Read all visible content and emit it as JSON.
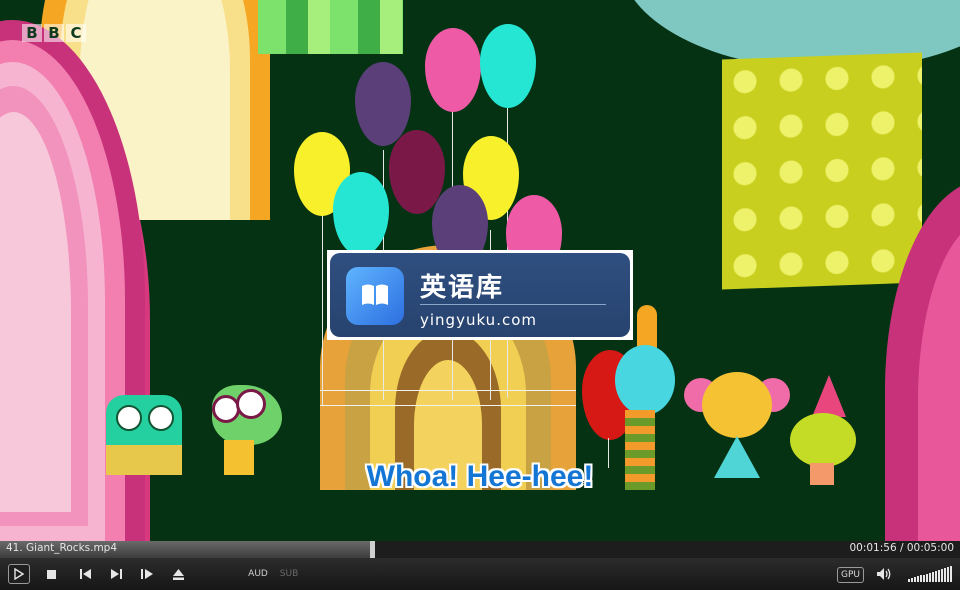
{
  "player": {
    "filename": "41. Giant_Rocks.mp4",
    "time_current": "00:01:56",
    "time_total": "00:05:00",
    "time_display": "00:01:56 / 00:05:00",
    "progress_fraction": 0.387,
    "volume_fraction": 1.0
  },
  "video": {
    "watermark_letters": [
      "B",
      "B",
      "C"
    ],
    "subtitle": "Whoa! Hee-hee!",
    "overlay_logo": {
      "title": "英语库",
      "domain": "yingyuku.com"
    }
  },
  "controls": {
    "play_icon": "play-icon",
    "stop_icon": "stop-icon",
    "prev_icon": "skip-previous-icon",
    "next_icon": "skip-next-icon",
    "frame_step_icon": "frame-step-icon",
    "eject_icon": "eject-icon",
    "audio_label": "AUD",
    "subtitle_label": "SUB",
    "gpu_label": "GPU",
    "speaker_icon": "speaker-icon"
  },
  "colors": {
    "background_green": "#063214",
    "subtitle_blue": "#1476d4",
    "logo_navy": "#2f4f80"
  }
}
